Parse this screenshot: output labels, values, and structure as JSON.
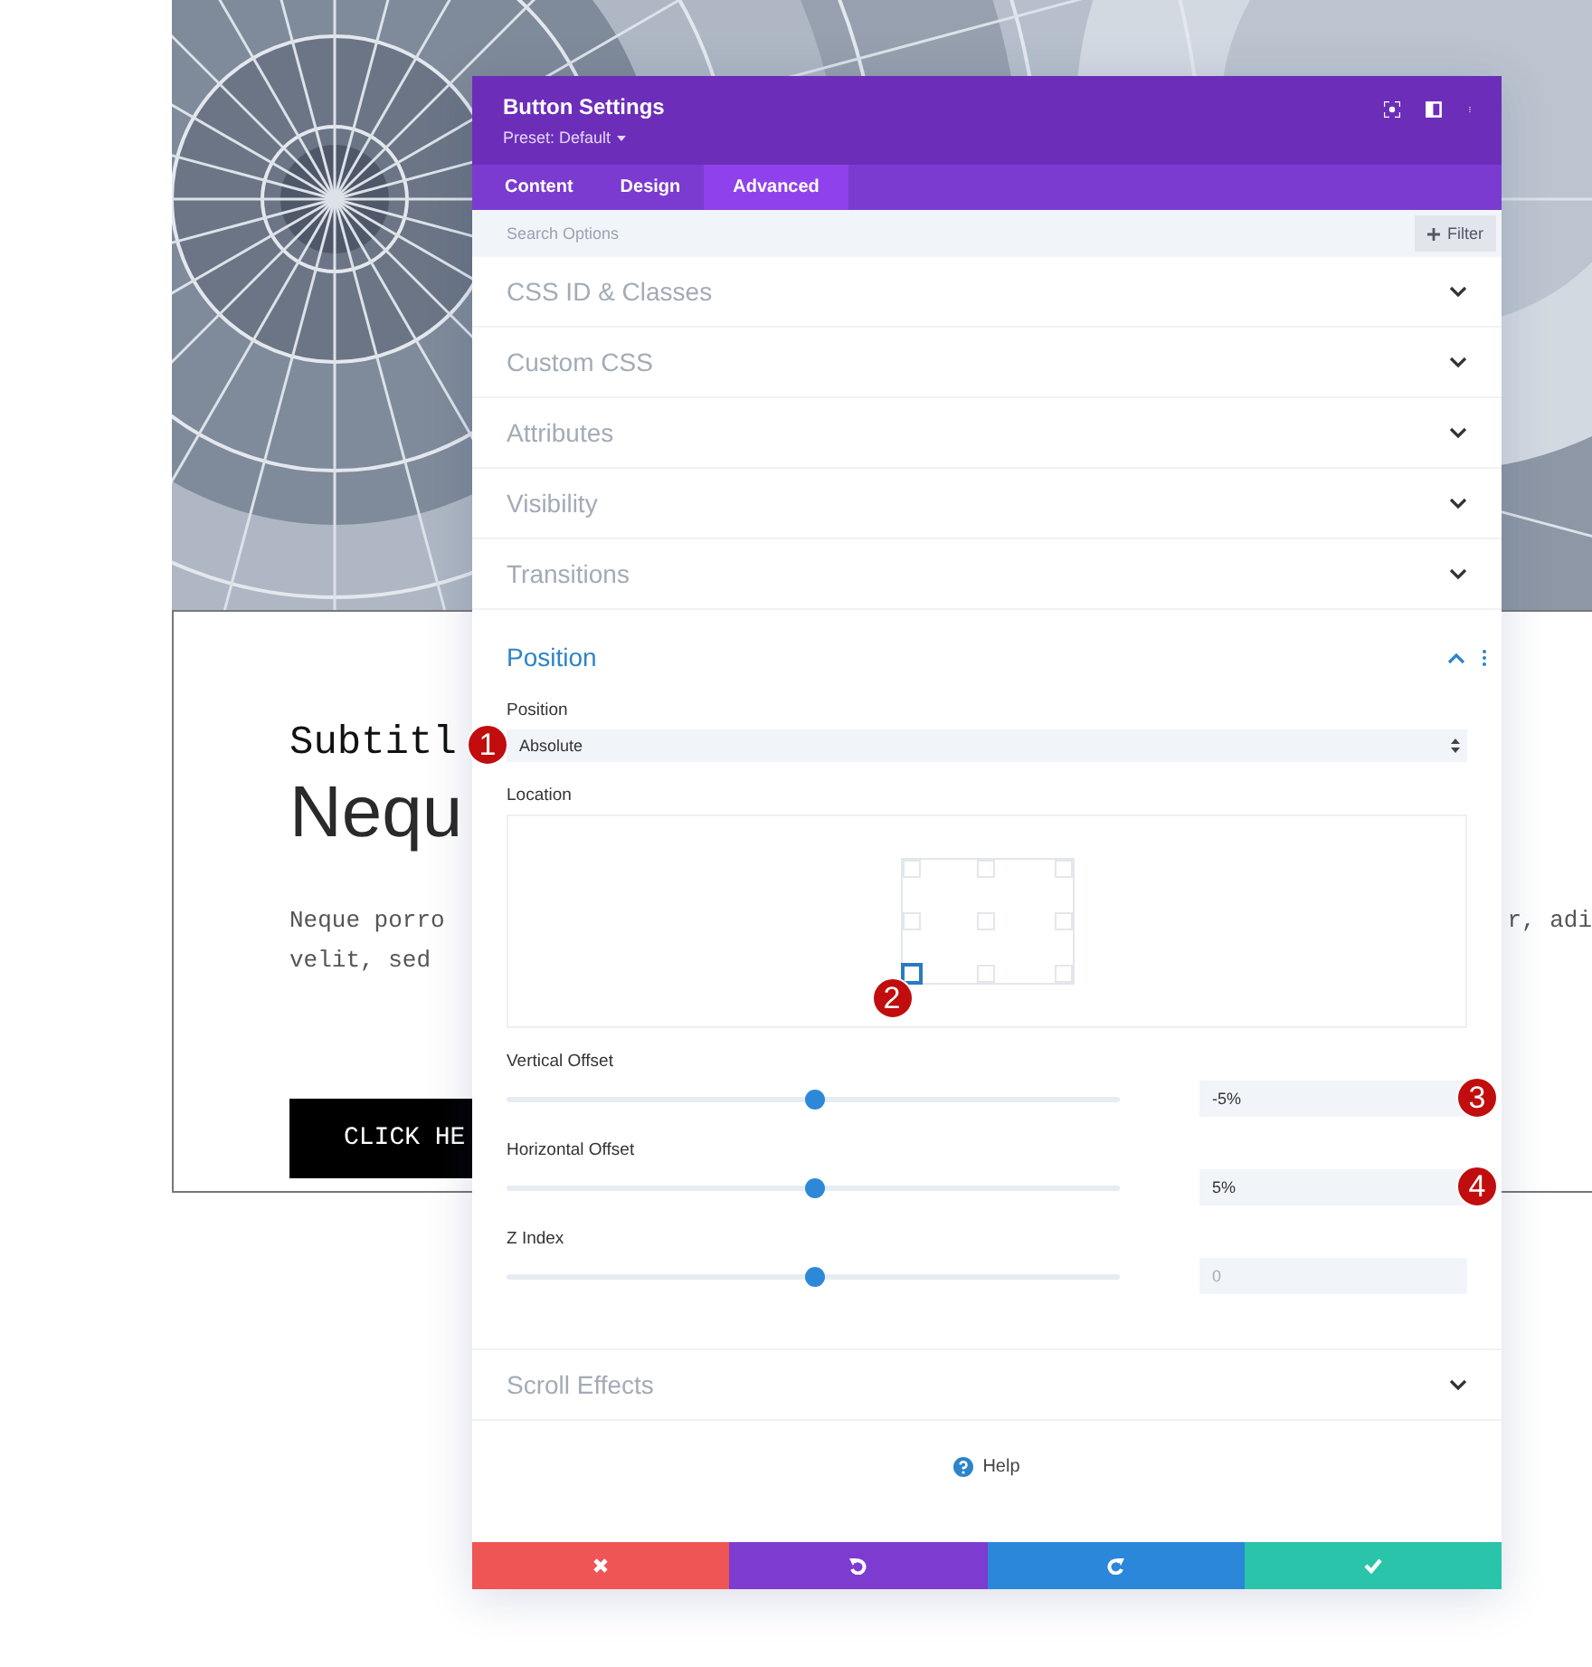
{
  "page": {
    "subtitle": "Subtitl",
    "heading": "Nequ",
    "paragraph_lines": [
      {
        "left": "Neque porro",
        "right": "r, adi"
      },
      {
        "left": "velit, sed"
      }
    ],
    "cta": "CLICK HE"
  },
  "modal": {
    "title": "Button Settings",
    "preset": "Preset: Default",
    "tabs": [
      {
        "label": "Content",
        "selected": false
      },
      {
        "label": "Design",
        "selected": false
      },
      {
        "label": "Advanced",
        "selected": true
      }
    ],
    "search": {
      "placeholder": "Search Options",
      "filter": "Filter"
    },
    "sections": [
      {
        "title": "CSS ID & Classes",
        "expanded": false
      },
      {
        "title": "Custom CSS",
        "expanded": false
      },
      {
        "title": "Attributes",
        "expanded": false
      },
      {
        "title": "Visibility",
        "expanded": false
      },
      {
        "title": "Transitions",
        "expanded": false
      },
      {
        "title": "Position",
        "expanded": true,
        "fields": [
          {
            "kind": "select",
            "label": "Position",
            "value": "Absolute",
            "annotation": "1"
          },
          {
            "kind": "location",
            "label": "Location",
            "annotation": "2",
            "cells": [
              {
                "selected": false
              },
              {
                "selected": false
              },
              {
                "selected": false
              },
              {
                "selected": false
              },
              {
                "selected": false
              },
              {
                "selected": false
              },
              {
                "selected": true
              },
              {
                "selected": false
              },
              {
                "selected": false
              }
            ]
          },
          {
            "kind": "slider",
            "label": "Vertical Offset",
            "level": 0.5,
            "value": "-5%",
            "annotation": "3"
          },
          {
            "kind": "slider",
            "label": "Horizontal Offset",
            "level": 0.5,
            "value": "5%",
            "annotation": "4"
          },
          {
            "kind": "slider",
            "label": "Z Index",
            "level": 0.5,
            "placeholder": "0"
          }
        ]
      },
      {
        "title": "Scroll Effects",
        "expanded": false
      }
    ],
    "help": "Help",
    "footer_buttons": [
      {
        "kind": "cancel",
        "color": "#ef5555"
      },
      {
        "kind": "undo",
        "color": "#7e3bd0"
      },
      {
        "kind": "redo",
        "color": "#2b87da"
      },
      {
        "kind": "save",
        "color": "#29c4a9"
      }
    ]
  }
}
